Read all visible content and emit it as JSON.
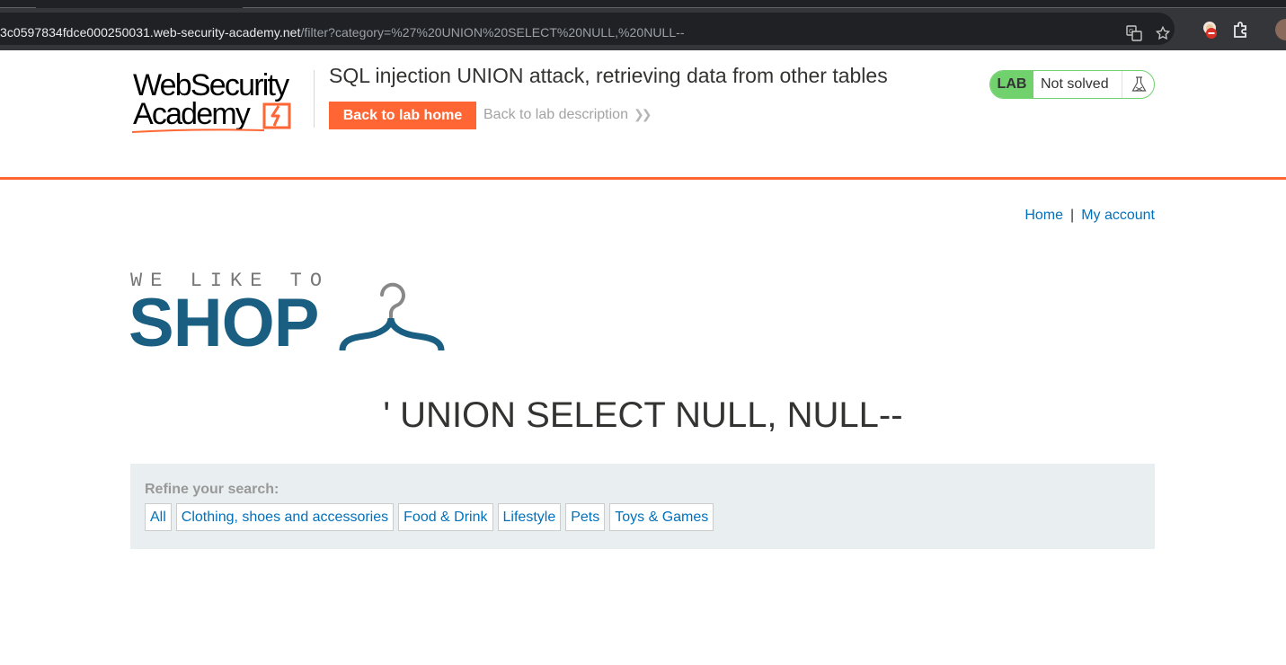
{
  "browser": {
    "url_host": "3c0597834fdce000250031.web-security-academy.net",
    "url_path": "/filter?category=%27%20UNION%20SELECT%20NULL,%20NULL--",
    "icons": [
      "translate-icon",
      "bookmark-star-icon",
      "extension-blocker-icon",
      "extensions-puzzle-icon"
    ]
  },
  "lab_header": {
    "logo_line1": "WebSecurity",
    "logo_line2": "Academy",
    "title": "SQL injection UNION attack, retrieving data from other tables",
    "back_home_label": "Back to lab home",
    "back_desc_label": "Back to lab description",
    "status_tag": "LAB",
    "status_text": "Not solved",
    "colors": {
      "accent": "#ff6633",
      "status_green": "#70d16d"
    }
  },
  "nav": {
    "home": "Home",
    "separator": "|",
    "account": "My account"
  },
  "shop_logo": {
    "tagline": "WE LIKE TO",
    "word": "SHOP",
    "color": "#1a5f82"
  },
  "page_heading": "' UNION SELECT NULL, NULL--",
  "filter": {
    "label": "Refine your search:",
    "categories": [
      "All",
      "Clothing, shoes and accessories",
      "Food & Drink",
      "Lifestyle",
      "Pets",
      "Toys & Games"
    ]
  }
}
